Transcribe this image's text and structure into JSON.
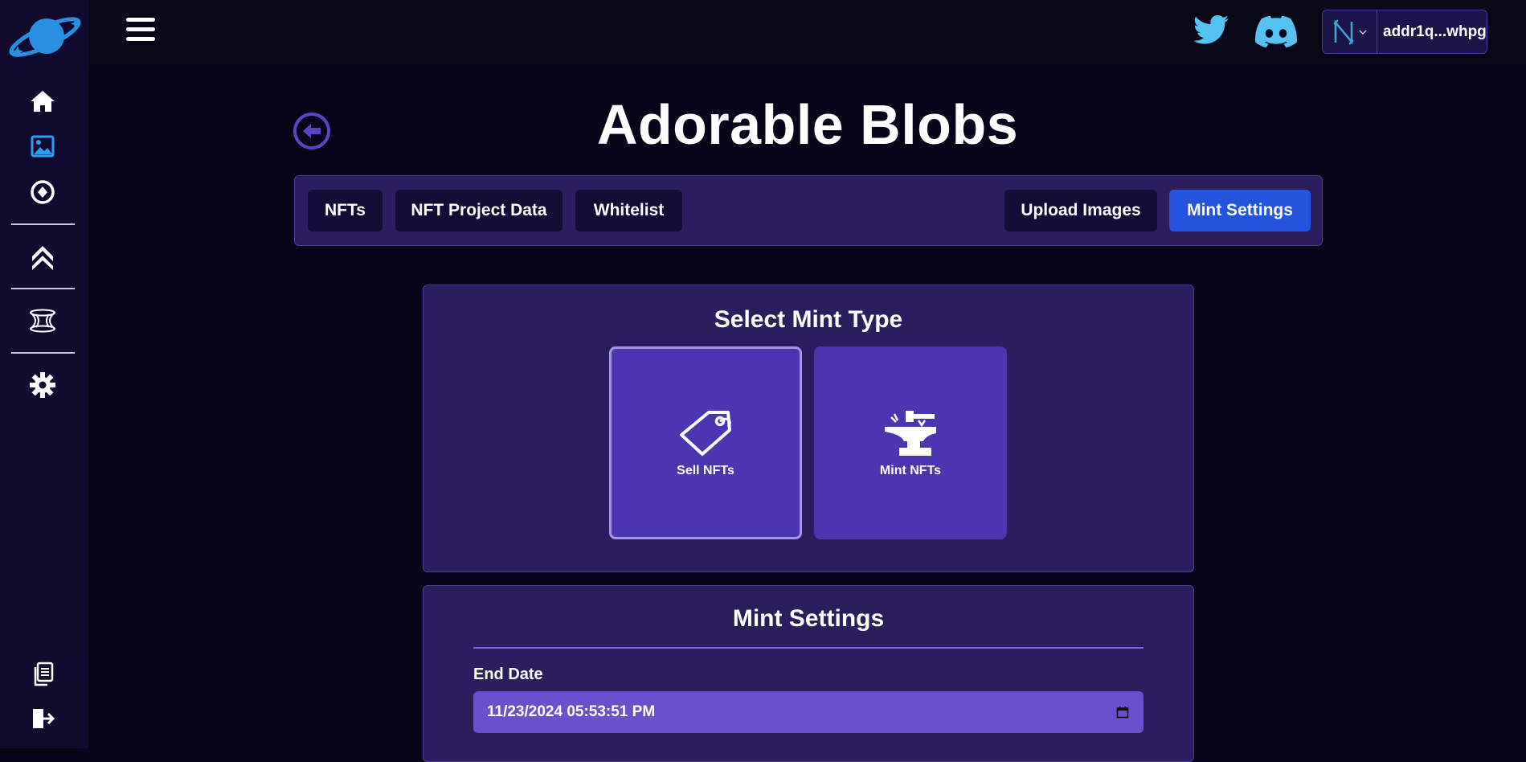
{
  "header": {
    "title": "Adorable Blobs",
    "wallet_address": "addr1q...whpg"
  },
  "tabs": [
    {
      "label": "NFTs"
    },
    {
      "label": "NFT Project Data"
    },
    {
      "label": "Whitelist"
    },
    {
      "label": "Upload Images"
    },
    {
      "label": "Mint Settings",
      "active": true
    }
  ],
  "mint_type": {
    "title": "Select Mint Type",
    "options": [
      {
        "label": "Sell NFTs",
        "icon": "price-tag-icon",
        "selected": true
      },
      {
        "label": "Mint NFTs",
        "icon": "anvil-icon",
        "selected": false
      }
    ]
  },
  "mint_settings": {
    "title": "Mint Settings",
    "end_date_label": "End Date",
    "end_date_value": "11/23/2024 05:53:51 PM"
  },
  "colors": {
    "background": "#06051a",
    "sidebar": "#100b2e",
    "panel": "#2a1e5e",
    "accent": "#2454dd",
    "card": "#4c35b0",
    "input": "#6a50cc",
    "active_nav_icon": "#2a9df4",
    "social_icons": "#55c3f2"
  }
}
